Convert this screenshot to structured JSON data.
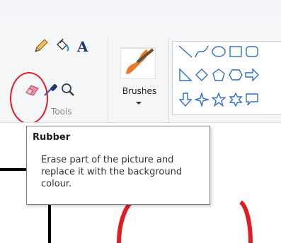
{
  "ribbon": {
    "tools_group_label": "Tools",
    "brushes_label": "Brushes"
  },
  "tooltip": {
    "title": "Rubber",
    "body": "Erase part of the picture and replace it with the background colour."
  },
  "icons": {
    "tools": [
      "pencil-icon",
      "fill-bucket-icon",
      "text-icon",
      "eraser-icon",
      "color-picker-icon",
      "magnifier-icon"
    ],
    "shapes": [
      "line-icon",
      "curve-icon",
      "oval-icon",
      "rectangle-icon",
      "rounded-rectangle-icon",
      "triangle-icon",
      "diamond-icon",
      "pentagon-icon",
      "hexagon-icon",
      "right-arrow-icon",
      "down-arrow-icon",
      "four-point-star-icon",
      "five-point-star-icon",
      "six-point-star-icon",
      "callout-icon"
    ]
  },
  "colors": {
    "highlight": "#e31b23",
    "shape_outline": "#2f6fc7",
    "drawing_black": "#000000",
    "drawing_red": "#e31b23"
  }
}
